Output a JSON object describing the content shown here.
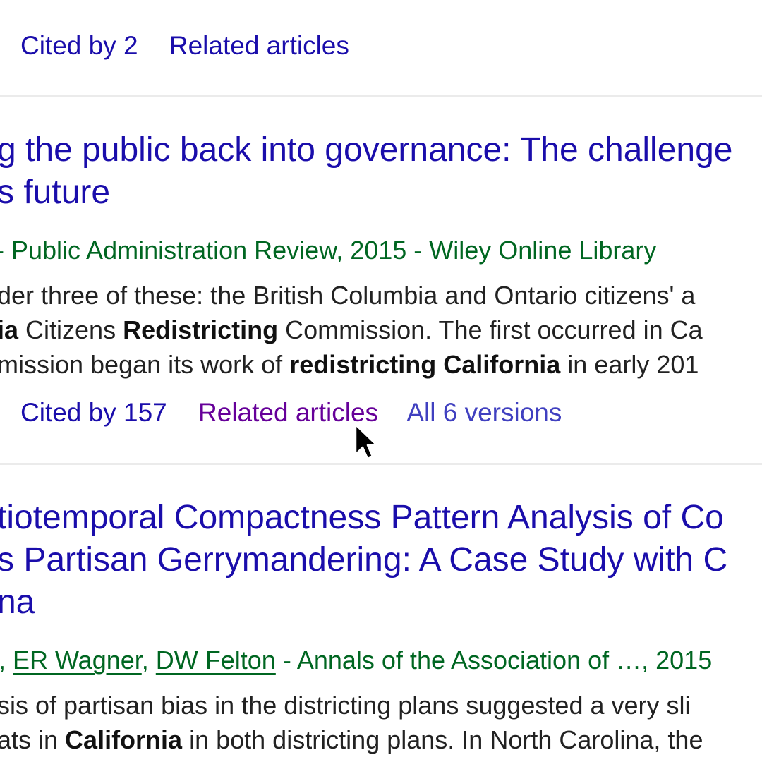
{
  "result1": {
    "cited_by": "Cited by 2",
    "related": "Related articles"
  },
  "result2": {
    "title_line1": "g the public back into governance: The challenge",
    "title_line2": "s future",
    "meta": "- Public Administration Review, 2015 - Wiley Online Library",
    "snippet_line1": "der three of these: the British Columbia and Ontario citizens' a",
    "snippet_line2": {
      "p1": "ia",
      "p2": " Citizens ",
      "p3": "Redistricting",
      "p4": " Commission. The first occurred in Ca"
    },
    "snippet_line3": {
      "p1": "mission began its work of ",
      "p2": "redistricting",
      "p3": " ",
      "p4": "California",
      "p5": " in early 201"
    },
    "cited_by": "Cited by 157",
    "related": "Related articles",
    "versions": "All 6 versions"
  },
  "result3": {
    "title_line1": "tiotemporal Compactness Pattern Analysis of Co",
    "title_line2": "s Partisan Gerrymandering: A Case Study with C",
    "title_line3": "na",
    "author_sep0": ", ",
    "author1": "ER Wagner",
    "author_sep": ", ",
    "author2": "DW Felton",
    "meta_rest": " - Annals of the Association of …, 2015",
    "snippet_line1": "sis of partisan bias in the districting plans suggested a very sli",
    "snippet_line2": {
      "p1": "ats in ",
      "p2": "California",
      "p3": " in both districting plans. In North Carolina, the"
    }
  },
  "icons": {
    "cursor": "mouse-pointer-icon"
  },
  "colors": {
    "link": "#1a0dab",
    "visited": "#660099",
    "green": "#006621",
    "text": "#222222"
  }
}
